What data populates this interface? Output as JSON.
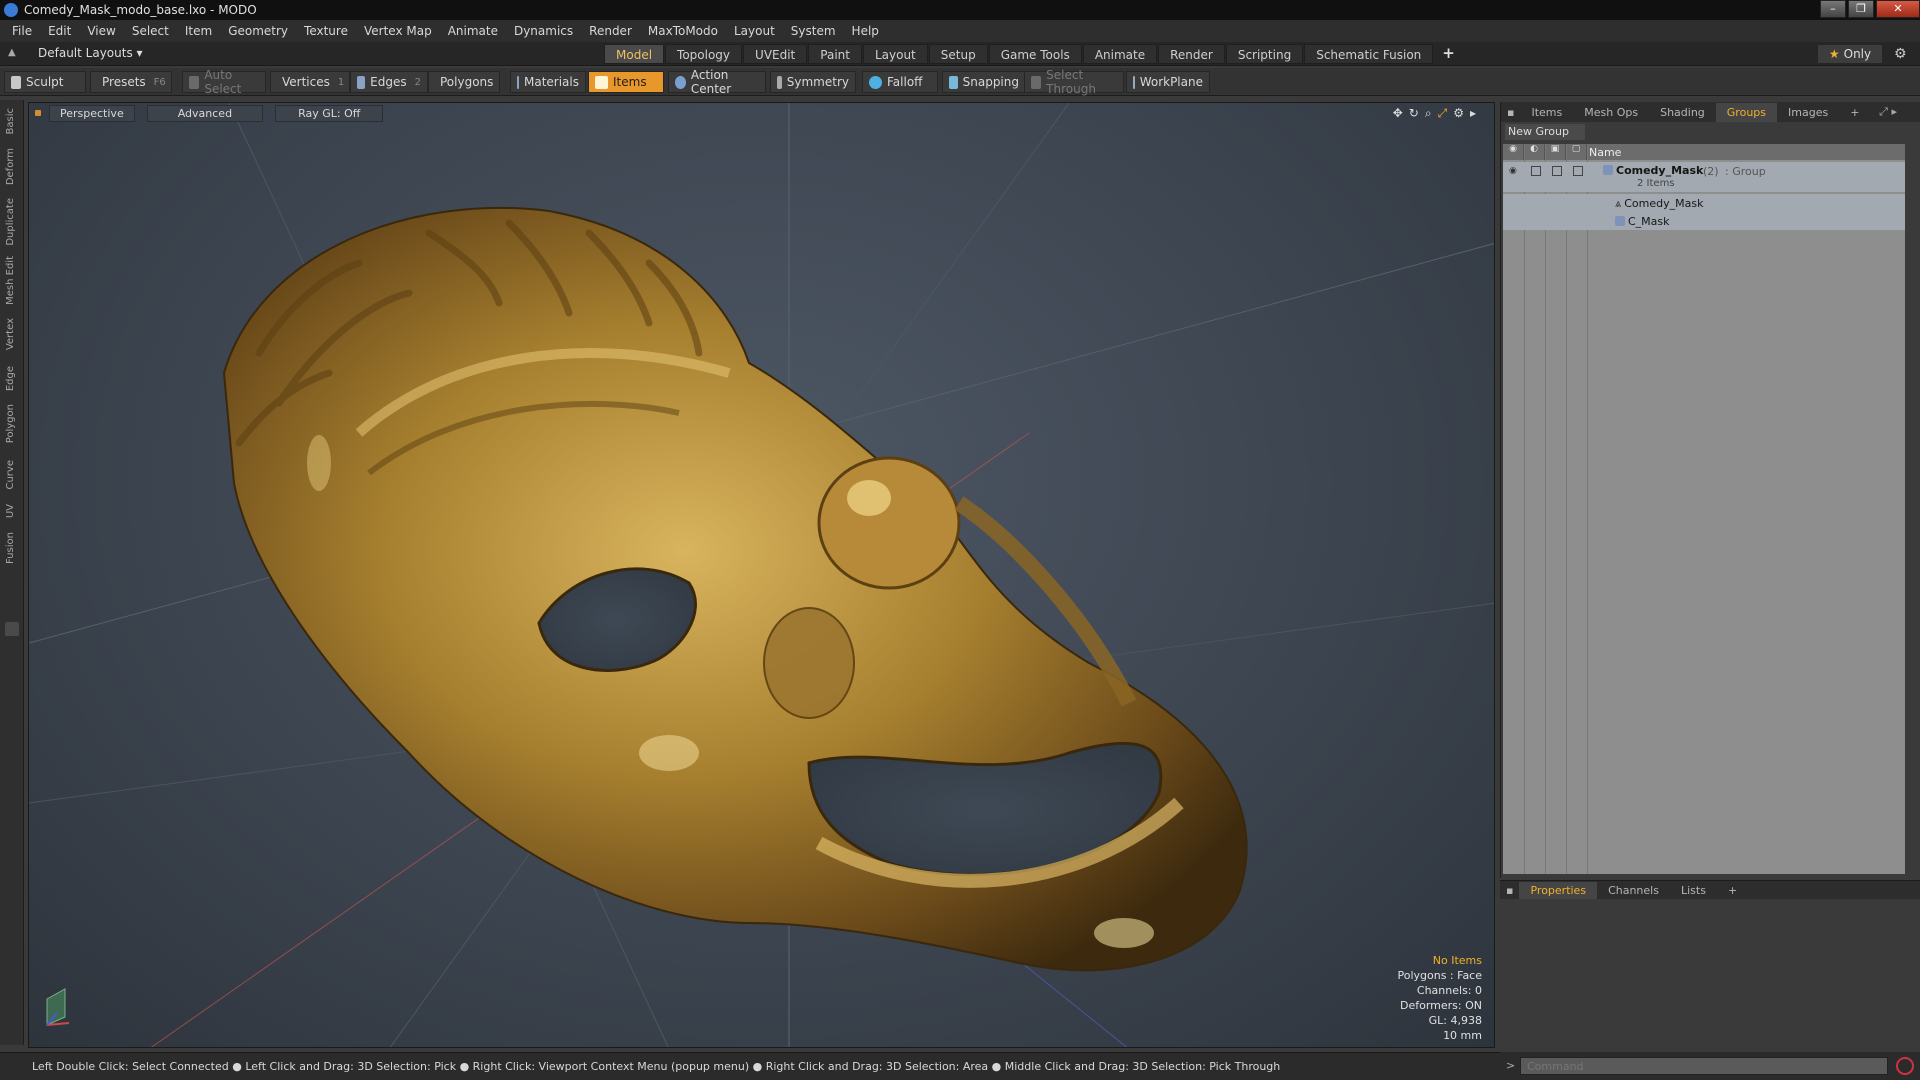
{
  "window": {
    "title": "Comedy_Mask_modo_base.lxo - MODO"
  },
  "menu": [
    "File",
    "Edit",
    "View",
    "Select",
    "Item",
    "Geometry",
    "Texture",
    "Vertex Map",
    "Animate",
    "Dynamics",
    "Render",
    "MaxToModo",
    "Layout",
    "System",
    "Help"
  ],
  "layout_bar": {
    "default_layouts": "Default Layouts ▾",
    "tabs": [
      "Model",
      "Topology",
      "UVEdit",
      "Paint",
      "Layout",
      "Setup",
      "Game Tools",
      "Animate",
      "Render",
      "Scripting",
      "Schematic Fusion"
    ],
    "active_tab": "Model",
    "only_label": "Only"
  },
  "toolbar": {
    "sculpt": "Sculpt",
    "presets": "Presets",
    "presets_key": "F6",
    "auto_select": "Auto Select",
    "vertices": "Vertices",
    "vertices_key": "1",
    "edges": "Edges",
    "edges_key": "2",
    "polygons": "Polygons",
    "materials": "Materials",
    "items": "Items",
    "action_center": "Action Center",
    "symmetry": "Symmetry",
    "falloff": "Falloff",
    "snapping": "Snapping",
    "select_through": "Select Through",
    "workplane": "WorkPlane"
  },
  "left_tabs": [
    "Basic",
    "Deform",
    "Duplicate",
    "Mesh Edit",
    "Vertex",
    "Edge",
    "Polygon",
    "Curve",
    "UV",
    "Fusion"
  ],
  "viewport": {
    "perspective": "Perspective",
    "advanced": "Advanced",
    "raygl": "Ray GL: Off",
    "info": {
      "no_items": "No Items",
      "polygons": "Polygons : Face",
      "channels": "Channels: 0",
      "deformers": "Deformers: ON",
      "gl": "GL: 4,938",
      "scale": "10 mm"
    }
  },
  "right_panel": {
    "tabs": [
      "Items",
      "Mesh Ops",
      "Shading",
      "Groups",
      "Images"
    ],
    "active_tab": "Groups",
    "new_group": "New Group",
    "name_header": "Name",
    "group": {
      "name": "Comedy_Mask",
      "count": "(2)",
      "type": ": Group",
      "items_label": "2 Items"
    },
    "children": [
      "Comedy_Mask",
      "C_Mask"
    ]
  },
  "properties_panel": {
    "tabs": [
      "Properties",
      "Channels",
      "Lists"
    ],
    "active_tab": "Properties"
  },
  "status": {
    "message": "Left Double Click: Select Connected ● Left Click and Drag: 3D Selection: Pick ● Right Click: Viewport Context Menu (popup menu) ● Right Click and Drag: 3D Selection: Area ● Middle Click and Drag: 3D Selection: Pick Through"
  },
  "command": {
    "placeholder": "Command"
  },
  "colors": {
    "accent": "#f0b030",
    "active_tool": "#e8982a",
    "mask_gold": "#a7802f"
  }
}
